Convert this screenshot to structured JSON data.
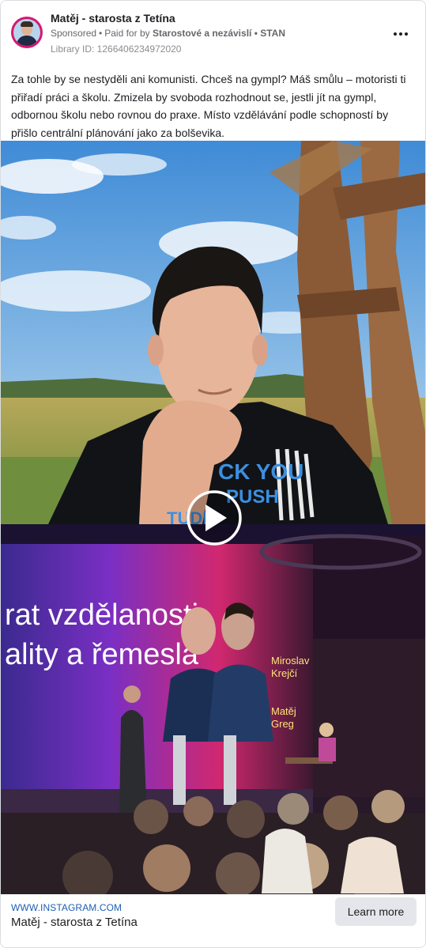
{
  "post": {
    "page_name": "Matěj - starosta z Tetína",
    "sponsored": "Sponsored",
    "separator": "•",
    "paid_for_by_prefix": "Paid for by",
    "payer": "Starostové a nezávislí • STAN",
    "library_id": "Library ID: 1266406234972020",
    "body_text": "Za tohle by se nestyděli ani komunisti. Chceš na gympl? Máš smůlu – motoristi ti přiřadí práci a školu. Zmizela by svoboda rozhodnout se, jestli jít na gympl, odbornou školu nebo rovnou do praxe. Místo vzdělávání podle schopností by přišlo centrální plánování jako za bolševika."
  },
  "media": {
    "shirt_text_line1": "CK YOU",
    "shirt_text_line2": "PUSH",
    "shirt_text_line3": "TUDE",
    "stage_text_line1": "rat vzdělanosti,",
    "stage_text_line2": "ality a řemesla",
    "speaker_label1_line1": "Miroslav",
    "speaker_label1_line2": "Krejčí",
    "speaker_label2_line1": "Matěj",
    "speaker_label2_line2": "Greg",
    "play_icon": "play-icon"
  },
  "footer": {
    "domain": "WWW.INSTAGRAM.COM",
    "title": "Matěj - starosta z Tetína",
    "cta_label": "Learn more"
  },
  "icons": {
    "more": "more-options-icon",
    "avatar": "page-avatar"
  },
  "colors": {
    "link": "#1d5fb4",
    "cta_bg": "#e4e6eb",
    "avatar_ring": "#d6186f"
  }
}
